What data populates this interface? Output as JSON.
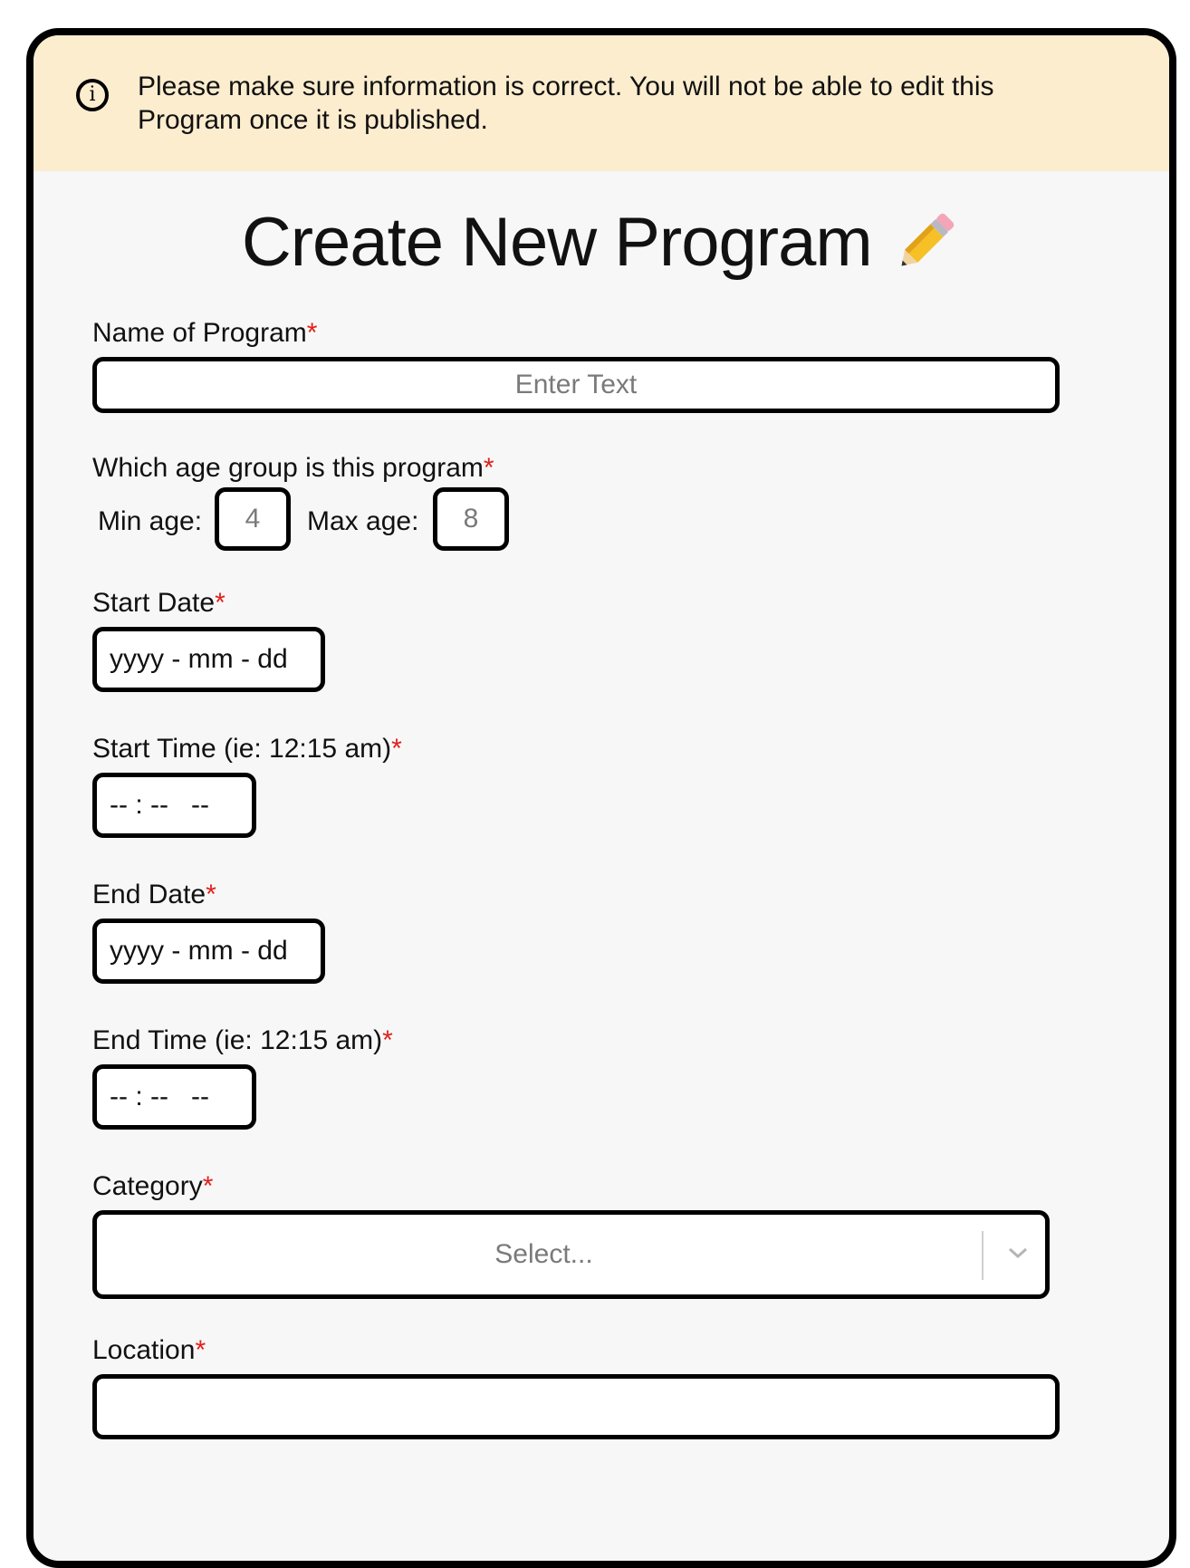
{
  "banner": {
    "icon": "info-icon",
    "message": "Please make sure information is correct. You will not be able to edit this Program once it is published."
  },
  "page": {
    "title": "Create New Program",
    "title_icon": "pencil-icon"
  },
  "form": {
    "name": {
      "label": "Name of Program",
      "required": "*",
      "placeholder": "Enter Text",
      "value": ""
    },
    "age_group": {
      "label": "Which age group is this program",
      "required": "*",
      "min_label": "Min age:",
      "min_placeholder": "4",
      "max_label": "Max age:",
      "max_placeholder": "8"
    },
    "start_date": {
      "label": "Start Date",
      "required": "*",
      "placeholder": "yyyy - mm - dd"
    },
    "start_time": {
      "label": "Start Time (ie: 12:15 am)",
      "required": "*",
      "placeholder": "-- : --   --"
    },
    "end_date": {
      "label": "End Date",
      "required": "*",
      "placeholder": "yyyy - mm - dd"
    },
    "end_time": {
      "label": "End Time (ie: 12:15 am)",
      "required": "*",
      "placeholder": "-- : --   --"
    },
    "category": {
      "label": "Category",
      "required": "*",
      "placeholder": "Select...",
      "icon": "chevron-down-icon"
    },
    "location": {
      "label": "Location",
      "required": "*",
      "value": ""
    }
  },
  "colors": {
    "banner_bg": "#fcedcf",
    "card_bg": "#f7f7f7",
    "required": "#e0201b",
    "border": "#000000"
  }
}
